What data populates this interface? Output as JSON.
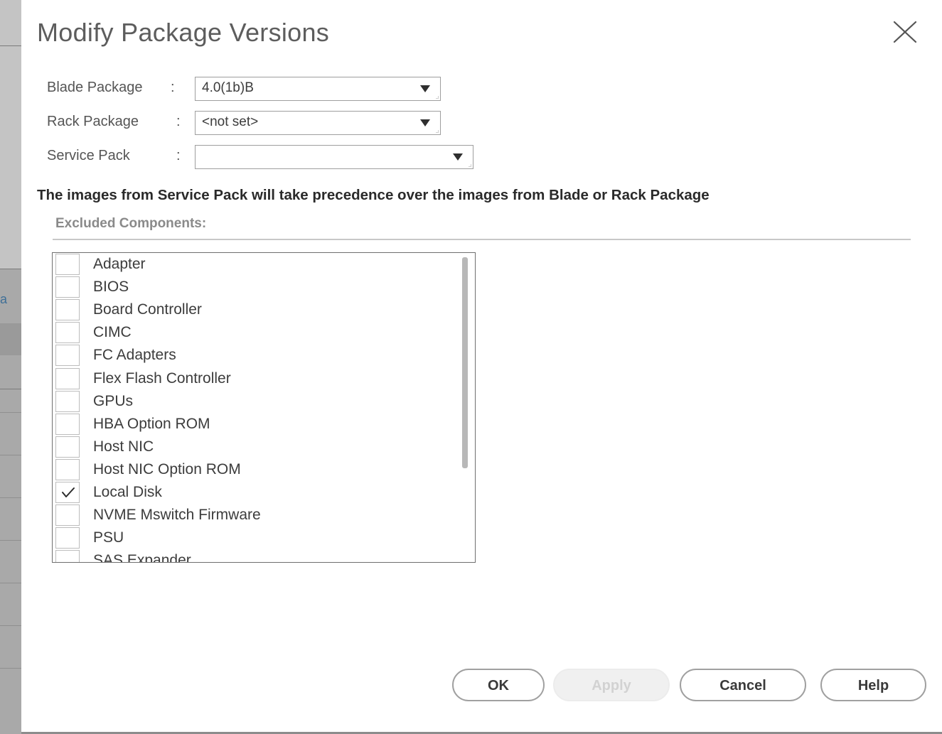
{
  "background": {
    "peek_text": "a"
  },
  "dialog": {
    "title": "Modify Package Versions",
    "close_icon": "close-icon",
    "form": {
      "blade_package": {
        "label": "Blade Package",
        "colon": ":",
        "value": "4.0(1b)B"
      },
      "rack_package": {
        "label": "Rack Package",
        "colon": ":",
        "value": "<not set>"
      },
      "service_pack": {
        "label": "Service Pack",
        "colon": ":",
        "value": ""
      }
    },
    "notice": "The images from Service Pack will take precedence over the images from Blade or Rack Package",
    "excluded_components": {
      "title": "Excluded Components:",
      "items": [
        {
          "label": "Adapter",
          "checked": false
        },
        {
          "label": "BIOS",
          "checked": false
        },
        {
          "label": "Board Controller",
          "checked": false
        },
        {
          "label": "CIMC",
          "checked": false
        },
        {
          "label": "FC Adapters",
          "checked": false
        },
        {
          "label": "Flex Flash Controller",
          "checked": false
        },
        {
          "label": "GPUs",
          "checked": false
        },
        {
          "label": "HBA Option ROM",
          "checked": false
        },
        {
          "label": "Host NIC",
          "checked": false
        },
        {
          "label": "Host NIC Option ROM",
          "checked": false
        },
        {
          "label": "Local Disk",
          "checked": true
        },
        {
          "label": "NVME Mswitch Firmware",
          "checked": false
        },
        {
          "label": "PSU",
          "checked": false
        },
        {
          "label": "SAS Expander",
          "checked": false
        }
      ]
    },
    "buttons": {
      "ok": "OK",
      "apply": "Apply",
      "cancel": "Cancel",
      "help": "Help"
    }
  }
}
